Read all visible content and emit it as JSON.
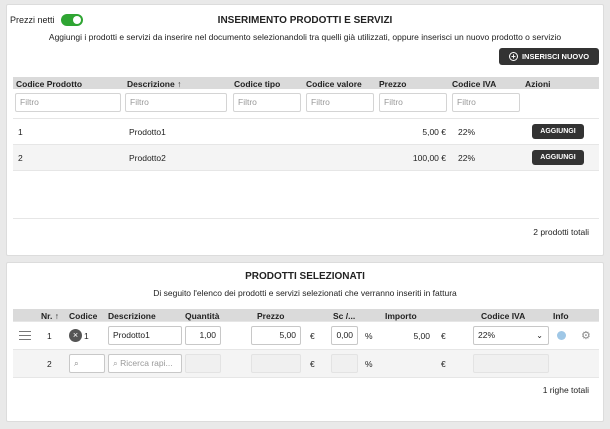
{
  "header": {
    "net_prices_label": "Prezzi netti",
    "net_prices_on": true
  },
  "products_panel": {
    "title": "INSERIMENTO PRODOTTI E SERVIZI",
    "subtitle": "Aggiungi i prodotti e servizi da inserire nel documento selezionandoli tra quelli già utilizzati, oppure inserisci un nuovo prodotto o servizio",
    "new_button": "INSERISCI NUOVO",
    "columns": [
      "Codice Prodotto",
      "Descrizione ↑",
      "Codice tipo",
      "Codice valore",
      "Prezzo",
      "Codice IVA",
      "Azioni"
    ],
    "filter_placeholder": "Filtro",
    "rows": [
      {
        "code": "1",
        "description": "Prodotto1",
        "price": "5,00 €",
        "vat": "22%",
        "action": "AGGIUNGI"
      },
      {
        "code": "2",
        "description": "Prodotto2",
        "price": "100,00 €",
        "vat": "22%",
        "action": "AGGIUNGI"
      }
    ],
    "total": "2 prodotti totali"
  },
  "selected_panel": {
    "title": "PRODOTTI SELEZIONATI",
    "subtitle": "Di seguito l'elenco dei prodotti e servizi selezionati che verranno inseriti in fattura",
    "columns": [
      "Nr. ↑",
      "Codice",
      "Descrizione",
      "Quantità",
      "Prezzo",
      "Sc /...",
      "Importo",
      "Codice IVA",
      "Info"
    ],
    "rows": [
      {
        "nr": "1",
        "code": "1",
        "description": "Prodotto1",
        "quantity": "1,00",
        "price": "5,00",
        "currency": "€",
        "discount": "0,00",
        "percent": "%",
        "amount": "5,00",
        "amount_currency": "€",
        "vat": "22%"
      }
    ],
    "new_row": {
      "nr": "2",
      "search_placeholder": "Ricerca rapi...",
      "currency": "€",
      "percent": "%",
      "amount_currency": "€"
    },
    "total": "1 righe totali"
  }
}
